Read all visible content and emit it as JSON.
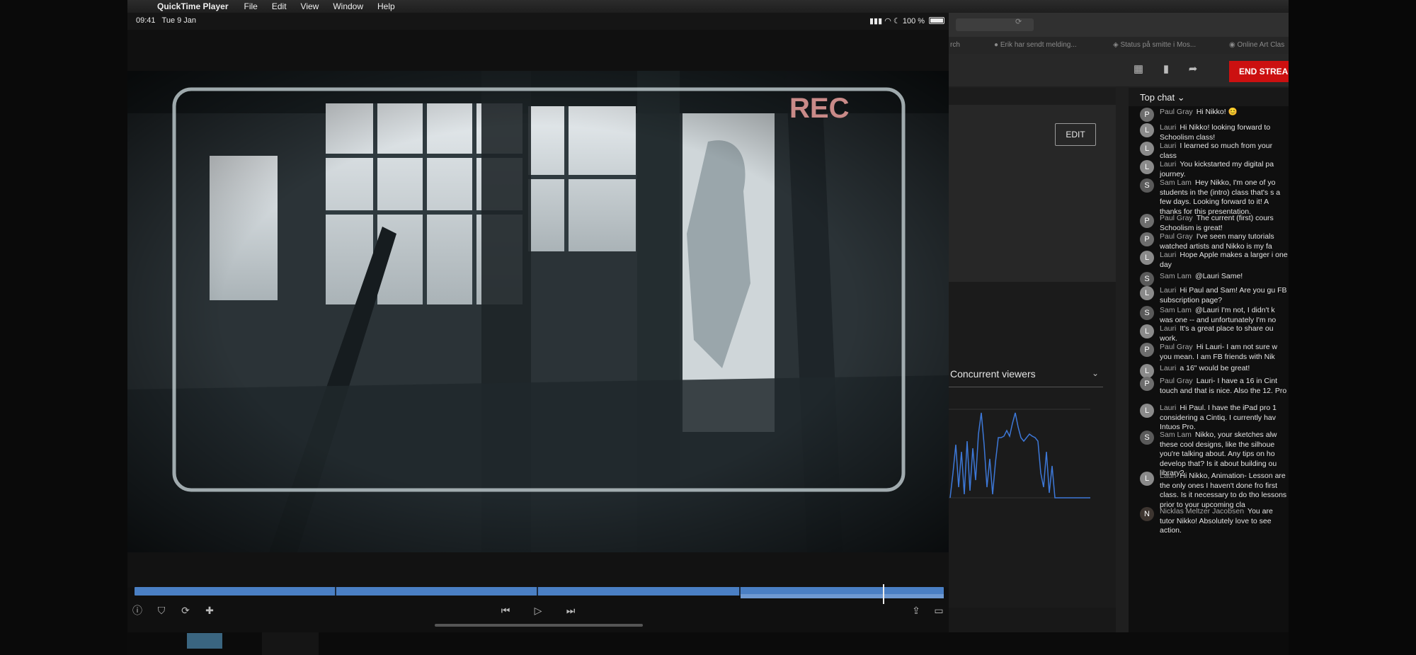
{
  "menubar": {
    "app_name": "QuickTime Player",
    "items": [
      "File",
      "Edit",
      "View",
      "Window",
      "Help"
    ]
  },
  "ipad_status": {
    "time": "09:41",
    "date": "Tue 9 Jan",
    "battery": "100 %"
  },
  "video": {
    "rec_label": "REC"
  },
  "player": {
    "progress": 0.925
  },
  "browser": {
    "bookmarks": [
      "rch",
      "Erik har sendt melding...",
      "Status på smitte i Mos...",
      "Online Art Clas"
    ]
  },
  "studio": {
    "end_stream_label": "END STREAM",
    "edit_label": "EDIT",
    "metric_label": "Concurrent viewers"
  },
  "chat": {
    "mode_label": "Top chat",
    "messages": [
      {
        "initial": "P",
        "author": "Paul Gray",
        "text": "Hi Nikko! 😊"
      },
      {
        "initial": "L",
        "author": "Lauri",
        "text": "Hi Nikko! looking forward to Schoolism class!"
      },
      {
        "initial": "L",
        "author": "Lauri",
        "text": "I learned so much from your class"
      },
      {
        "initial": "L",
        "author": "Lauri",
        "text": "You kickstarted my digital pa journey."
      },
      {
        "initial": "S",
        "author": "Sam Lam",
        "text": "Hey Nikko, I'm one of yo students in the (intro) class that's s a few days. Looking forward to it! A thanks for this presentation."
      },
      {
        "initial": "P",
        "author": "Paul Gray",
        "text": "The current (first) cours Schoolism is great!"
      },
      {
        "initial": "P",
        "author": "Paul Gray",
        "text": "I've seen many tutorials watched artists and Nikko is my fa"
      },
      {
        "initial": "L",
        "author": "Lauri",
        "text": "Hope Apple makes a larger i one day"
      },
      {
        "initial": "S",
        "author": "Sam Lam",
        "text": "@Lauri Same!"
      },
      {
        "initial": "L",
        "author": "Lauri",
        "text": "Hi Paul and Sam! Are you gu FB subscription page?"
      },
      {
        "initial": "S",
        "author": "Sam Lam",
        "text": "@Lauri I'm not, I didn't k was one -- and unfortunately I'm no"
      },
      {
        "initial": "L",
        "author": "Lauri",
        "text": "It's a great place to share ou work."
      },
      {
        "initial": "P",
        "author": "Paul Gray",
        "text": "Hi Lauri- I am not sure w you mean. I am FB friends with Nik"
      },
      {
        "initial": "L",
        "author": "Lauri",
        "text": "a 16\" would be great!"
      },
      {
        "initial": "P",
        "author": "Paul Gray",
        "text": "Lauri- I have a 16 in Cint touch and that is nice. Also the 12. Pro"
      },
      {
        "initial": "L",
        "author": "Lauri",
        "text": "Hi Paul. I have the iPad pro 1 considering a Cintiq. I currently hav Intuos Pro."
      },
      {
        "initial": "S",
        "author": "Sam Lam",
        "text": "Nikko, your sketches alw these cool designs, like the silhoue you're talking about. Any tips on ho develop that? Is it about building ou library?"
      },
      {
        "initial": "L",
        "author": "Lauri",
        "text": "Hi Nikko, Animation- Lesson are the only ones I haven't done fro first class. Is it necessary to do tho lessons prior to your upcoming cla"
      },
      {
        "initial": "N",
        "author": "Nicklas Meltzer Jacobsen",
        "text": "You are tutor Nikko! Absolutely love to see action."
      }
    ]
  }
}
